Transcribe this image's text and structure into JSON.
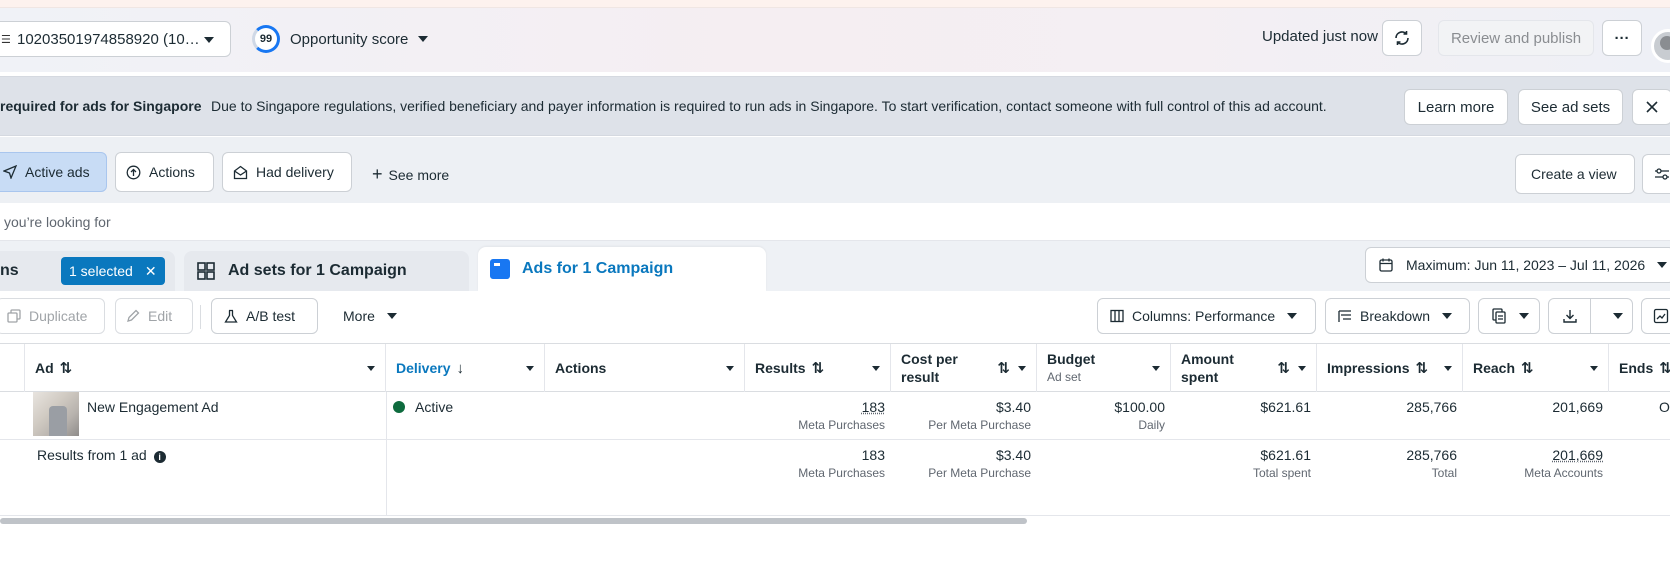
{
  "header": {
    "account_id": "10203501974858920 (10…",
    "opportunity_score": "99",
    "opportunity_label": "Opportunity score",
    "updated": "Updated just now",
    "review_publish": "Review and publish",
    "more_glyph": "···"
  },
  "banner": {
    "title": "required for ads for Singapore",
    "message": "Due to Singapore regulations, verified beneficiary and payer information is required to run ads in Singapore. To start verification, contact someone with full control of this ad account.",
    "learn_more": "Learn more",
    "see_ad_sets": "See ad sets"
  },
  "filters": {
    "active_ads": "Active ads",
    "actions": "Actions",
    "had_delivery": "Had delivery",
    "see_more": "See more",
    "create_view": "Create a view"
  },
  "search": {
    "placeholder": "you’re looking for"
  },
  "tabs": {
    "campaigns_partial": "ns",
    "selected": "1 selected",
    "ad_sets": "Ad sets for 1 Campaign",
    "ads": "Ads for 1 Campaign",
    "date_range": "Maximum: Jun 11, 2023 – Jul 11, 2026"
  },
  "toolbar": {
    "duplicate": "Duplicate",
    "edit": "Edit",
    "ab_test": "A/B test",
    "more": "More",
    "columns": "Columns: Performance",
    "breakdown": "Breakdown"
  },
  "table": {
    "columns": {
      "ad": "Ad",
      "delivery": "Delivery",
      "actions": "Actions",
      "results": "Results",
      "cost_per_result_1": "Cost per",
      "cost_per_result_2": "result",
      "budget": "Budget",
      "budget_sub": "Ad set",
      "amount_spent_1": "Amount",
      "amount_spent_2": "spent",
      "impressions": "Impressions",
      "reach": "Reach",
      "ends": "Ends"
    },
    "row": {
      "name": "New Engagement Ad",
      "delivery": "Active",
      "results": "183",
      "results_sub": "Meta Purchases",
      "cost": "$3.40",
      "cost_sub": "Per Meta Purchase",
      "budget": "$100.00",
      "budget_sub": "Daily",
      "spent": "$621.61",
      "impressions": "285,766",
      "reach": "201,669",
      "ends": "O"
    },
    "summary": {
      "label": "Results from 1 ad",
      "results": "183",
      "results_sub": "Meta Purchases",
      "cost": "$3.40",
      "cost_sub": "Per Meta Purchase",
      "spent": "$621.61",
      "spent_sub": "Total spent",
      "impressions": "285,766",
      "impressions_sub": "Total",
      "reach": "201,669",
      "reach_sub": "Meta Accounts"
    }
  },
  "colors": {
    "accent": "#0a78be",
    "active_dot": "#0e6b3e",
    "banner_bg": "#dee2e9"
  }
}
